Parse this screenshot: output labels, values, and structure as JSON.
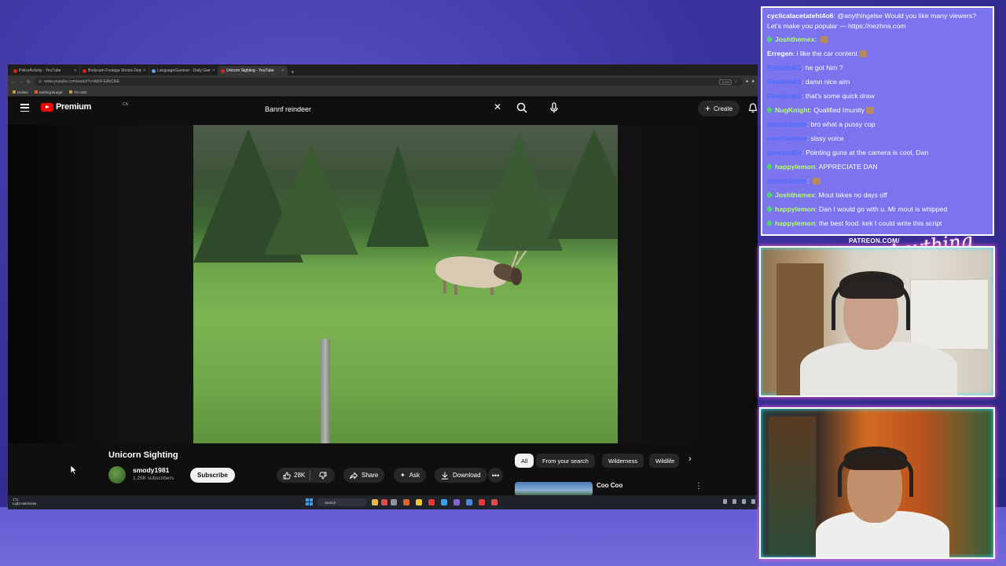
{
  "browser": {
    "tabs": [
      {
        "title": "PoliceActivity - YouTube",
        "active": false
      },
      {
        "title": "Bodycam Footage Shows Deput",
        "active": false
      },
      {
        "title": "LanguageGuesser - Daily Game",
        "active": false
      },
      {
        "title": "Unicorn Sighting - YouTube",
        "active": true
      }
    ],
    "url": "www.youtube.com/watch?v=AkW-EAbCIbE",
    "zoom": "110%",
    "bookmarks": [
      "Dailies",
      "Nothing Burger",
      "TO ADD"
    ]
  },
  "youtube": {
    "brand": "Premium",
    "country": "CA",
    "search_query": "Bannf reindeer",
    "create_label": "Create",
    "video_title": "Unicorn Sighting",
    "channel_name": "smody1981",
    "subscribers": "1.25K subscribers",
    "subscribe_label": "Subscribe",
    "likes": "28K",
    "share_label": "Share",
    "ask_label": "Ask",
    "download_label": "Download",
    "chips": [
      "All",
      "From your search",
      "Wilderness",
      "Wildlife"
    ],
    "rec_title": "Coo Coo"
  },
  "taskbar": {
    "weather_temp": "1°C",
    "weather_desc": "Light rain/snow",
    "search_label": "Search"
  },
  "chat": [
    {
      "user": "cyclicalacetateht4o6",
      "color": "#ffffff",
      "text": "@anythingelse Would you like many viewers? Let's make you popular — https://nezhna.com"
    },
    {
      "user": "Joshthemex",
      "color": "#b4ff6e",
      "text": "",
      "emote": true
    },
    {
      "user": "Erregen",
      "color": "#ffffff",
      "text": "i like the car content",
      "emote": true
    },
    {
      "user": "Fireb0mb1",
      "color": "#4a6cff",
      "text": "he got him ?"
    },
    {
      "user": "Fireb0mb1",
      "color": "#4a6cff",
      "text": "damn nice aim"
    },
    {
      "user": "Fireb0mb1",
      "color": "#4a6cff",
      "text": "that's some quick draw"
    },
    {
      "user": "NugKnight",
      "color": "#b4ff6e",
      "text": "Qualified Imunity",
      "emote": true
    },
    {
      "user": "raercharmer",
      "color": "#4a6cff",
      "text": "bro what a pussy cop"
    },
    {
      "user": "raercharmer",
      "color": "#4a6cff",
      "text": "sissy voice"
    },
    {
      "user": "abermulfin",
      "color": "#4a6cff",
      "text": "Pointing guns at the camera is cool, Dan"
    },
    {
      "user": "happylemon",
      "color": "#b4ff6e",
      "text": "APPRECIATE DAN"
    },
    {
      "user": "raercharmer",
      "color": "#4a6cff",
      "text": "",
      "emote": true
    },
    {
      "user": "Joshthemex",
      "color": "#b4ff6e",
      "text": "Mout takes no days off"
    },
    {
      "user": "happylemon",
      "color": "#b4ff6e",
      "text": "Dan I would go with u. Mr mout is whipped"
    },
    {
      "user": "happylemon",
      "color": "#b4ff6e",
      "text": "the best food. kek I could write this script"
    }
  ],
  "overlay": {
    "patreon": "PATREON.COM/",
    "brand_script": "Anything Else"
  },
  "colors": {
    "yt_red": "#ff0000",
    "chat_bg": "#7b74ee",
    "neon_pink": "#ff5fd2",
    "neon_cyan": "#33e4ff"
  }
}
